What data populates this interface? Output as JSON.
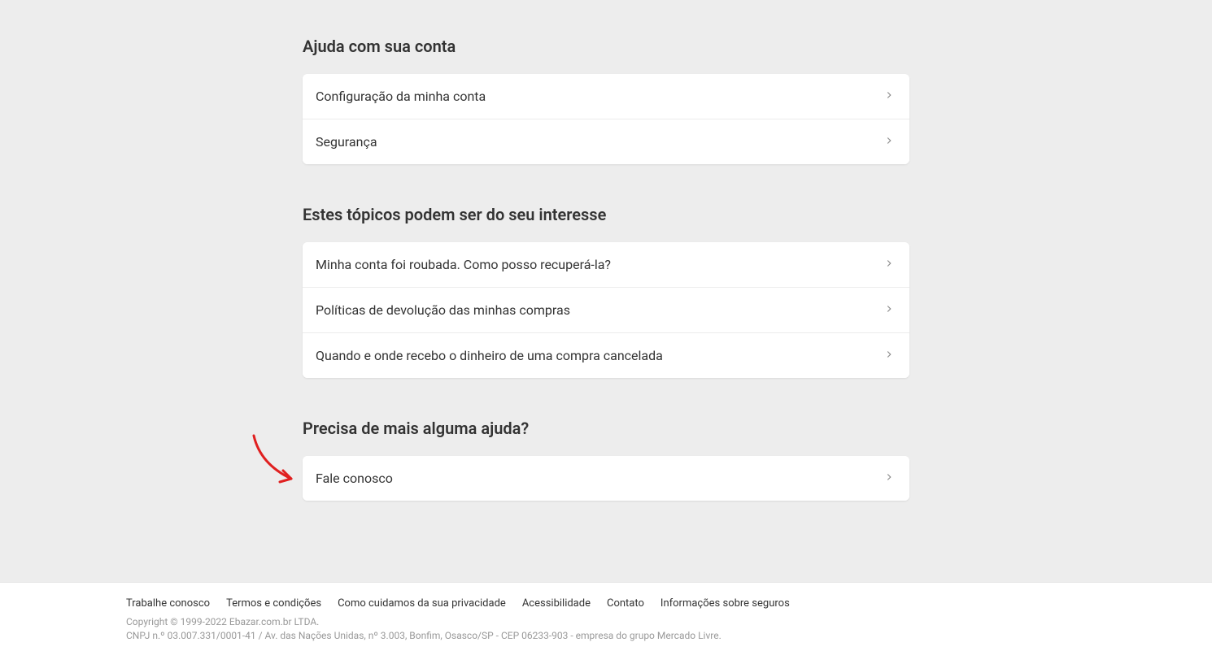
{
  "sections": {
    "account_help": {
      "heading": "Ajuda com sua conta",
      "items": [
        {
          "label": "Configuração da minha conta"
        },
        {
          "label": "Segurança"
        }
      ]
    },
    "topics": {
      "heading": "Estes tópicos podem ser do seu interesse",
      "items": [
        {
          "label": "Minha conta foi roubada. Como posso recuperá-la?"
        },
        {
          "label": "Políticas de devolução das minhas compras"
        },
        {
          "label": "Quando e onde recebo o dinheiro de uma compra cancelada"
        }
      ]
    },
    "more_help": {
      "heading": "Precisa de mais alguma ajuda?",
      "items": [
        {
          "label": "Fale conosco"
        }
      ]
    }
  },
  "footer": {
    "links": [
      "Trabalhe conosco",
      "Termos e condições",
      "Como cuidamos da sua privacidade",
      "Acessibilidade",
      "Contato",
      "Informações sobre seguros"
    ],
    "copyright": "Copyright © 1999-2022 Ebazar.com.br LTDA.",
    "address": "CNPJ n.º 03.007.331/0001-41 / Av. das Nações Unidas, nº 3.003, Bonfim, Osasco/SP - CEP 06233-903 - empresa do grupo Mercado Livre."
  }
}
